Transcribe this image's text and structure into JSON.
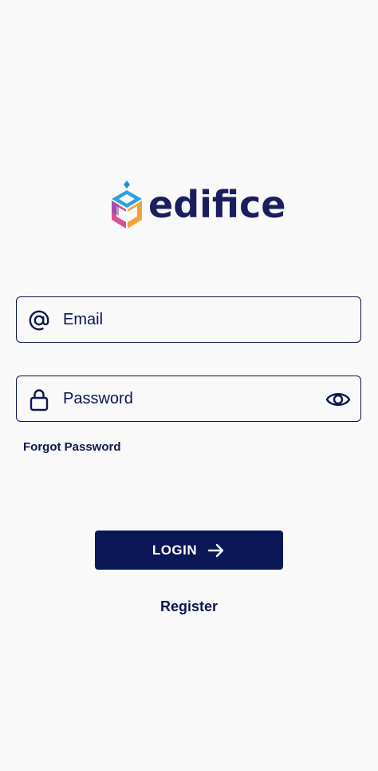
{
  "brand": {
    "name": "edifice",
    "colors": {
      "text": "#1b1e5e",
      "blue": "#1e90d6",
      "pink": "#e2549b",
      "orange": "#f4a13a",
      "purple": "#7a4fb2"
    }
  },
  "form": {
    "email": {
      "placeholder": "Email",
      "icon": "at-icon"
    },
    "password": {
      "placeholder": "Password",
      "icon": "lock-icon",
      "toggle_icon": "eye-icon"
    },
    "forgot_label": "Forgot Password"
  },
  "actions": {
    "login_label": "LOGIN",
    "login_icon": "arrow-right-icon",
    "register_label": "Register"
  },
  "theme": {
    "primary": "#0b1656",
    "background": "#f9f9f9"
  }
}
